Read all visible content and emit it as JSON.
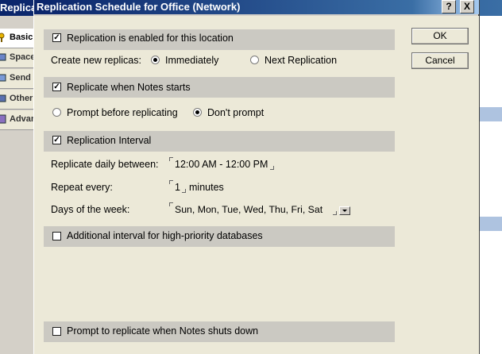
{
  "background_window": {
    "title": "Replicat",
    "tabs": [
      {
        "label": "Basic",
        "icon": "key-icon"
      },
      {
        "label": "Space",
        "icon": "disk-icon"
      },
      {
        "label": "Send",
        "icon": "send-icon"
      },
      {
        "label": "Other",
        "icon": "other-icon"
      },
      {
        "label": "Advanced",
        "icon": "advanced-icon"
      }
    ]
  },
  "dialog": {
    "title": "Replication Schedule for Office (Network)",
    "help_button": "?",
    "close_button": "X",
    "ok_label": "OK",
    "cancel_label": "Cancel",
    "enabled": {
      "label": "Replication is enabled for this location",
      "checked": true
    },
    "create_new": {
      "label": "Create new replicas:",
      "options": [
        {
          "label": "Immediately",
          "selected": true
        },
        {
          "label": "Next Replication",
          "selected": false
        }
      ]
    },
    "notes_start": {
      "label": "Replicate when Notes starts",
      "checked": true
    },
    "prompt": {
      "options": [
        {
          "label": "Prompt before replicating",
          "selected": false
        },
        {
          "label": "Don't prompt",
          "selected": true
        }
      ]
    },
    "interval": {
      "label": "Replication Interval",
      "checked": true
    },
    "daily": {
      "label": "Replicate daily between:",
      "value": "12:00 AM - 12:00 PM"
    },
    "repeat": {
      "label": "Repeat every:",
      "value": "1",
      "unit": "minutes"
    },
    "days": {
      "label": "Days of the week:",
      "value": "Sun, Mon, Tue, Wed, Thu, Fri, Sat"
    },
    "high_priority": {
      "label": "Additional interval for high-priority databases",
      "checked": false
    },
    "shutdown": {
      "label": "Prompt to replicate when Notes shuts down",
      "checked": false
    }
  },
  "colors": {
    "title_bar": "#0a246a",
    "dialog_bg": "#ece9d8",
    "section_band": "#cbc9c2"
  }
}
